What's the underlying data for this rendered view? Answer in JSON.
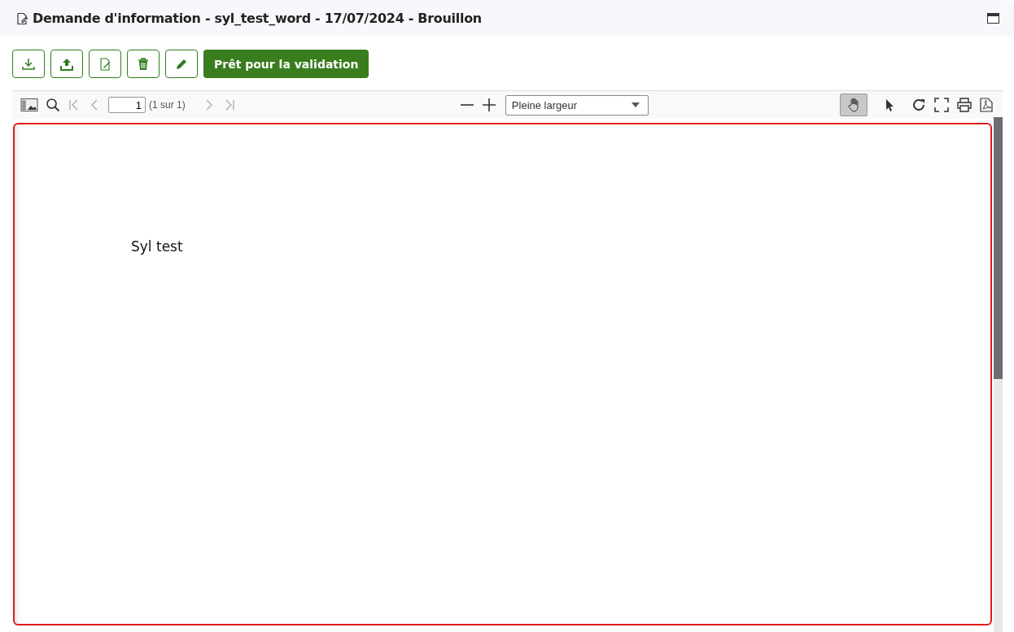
{
  "window": {
    "title": "Demande d'information - syl_test_word - 17/07/2024 - Brouillon"
  },
  "actions": [
    {
      "kind": "download"
    },
    {
      "kind": "upload"
    },
    {
      "kind": "sign"
    },
    {
      "kind": "trash"
    },
    {
      "kind": "pencil"
    },
    {
      "kind": "primary",
      "label": "Prêt pour la validation"
    }
  ],
  "viewer": {
    "page_input": "1",
    "page_count": "(1 sur 1)",
    "zoom": "Pleine largeur",
    "tools": [
      {
        "kind": "hand",
        "selected": true
      },
      {
        "kind": "pointer",
        "selected": false
      }
    ],
    "document_text": "Syl test"
  }
}
